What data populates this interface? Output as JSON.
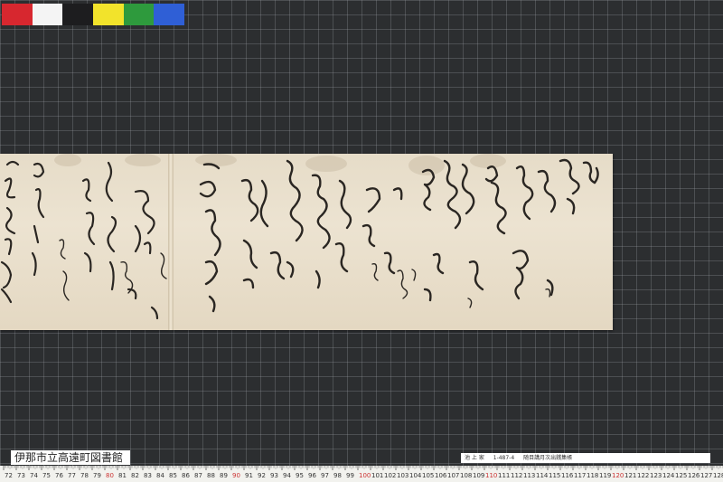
{
  "swatches": [
    "#d7272f",
    "#f4f4f4",
    "#1d1d1f",
    "#f2e32b",
    "#2e9a3d",
    "#2f5fd6"
  ],
  "library_label": "伊那市立高遠町図書館",
  "catalog_strip": [
    "池 上 家",
    "1-487-4",
    "随目講月次出銭集帳"
  ],
  "ruler": {
    "start": 72,
    "end": 128,
    "numbers": [
      "72",
      "73",
      "74",
      "75",
      "76",
      "77",
      "78",
      "79",
      "80",
      "81",
      "82",
      "83",
      "84",
      "85",
      "86",
      "87",
      "88",
      "89",
      "90",
      "91",
      "92",
      "93",
      "94",
      "95",
      "96",
      "97",
      "98",
      "99",
      "100",
      "101",
      "102",
      "103",
      "104",
      "105",
      "106",
      "107",
      "108",
      "109",
      "110",
      "111",
      "112",
      "113",
      "114",
      "115",
      "116",
      "117",
      "118",
      "119",
      "120",
      "121",
      "122",
      "123",
      "124",
      "125",
      "126",
      "127",
      "128"
    ]
  }
}
